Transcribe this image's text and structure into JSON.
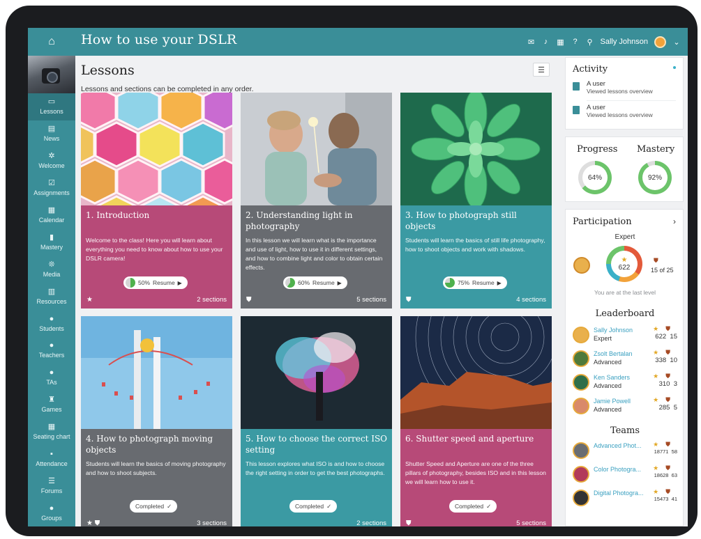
{
  "header": {
    "title": "How to use your DSLR",
    "user": "Sally Johnson"
  },
  "sidebar": {
    "items": [
      {
        "label": "Lessons",
        "icon": "lessons-icon",
        "glyph": "▭",
        "active": true
      },
      {
        "label": "News",
        "icon": "news-icon",
        "glyph": "▤"
      },
      {
        "label": "Welcome",
        "icon": "welcome-icon",
        "glyph": "✲"
      },
      {
        "label": "Assignments",
        "icon": "assignments-icon",
        "glyph": "☑"
      },
      {
        "label": "Calendar",
        "icon": "calendar-icon",
        "glyph": "▦"
      },
      {
        "label": "Mastery",
        "icon": "mastery-icon",
        "glyph": "▮"
      },
      {
        "label": "Media",
        "icon": "media-icon",
        "glyph": "❊"
      },
      {
        "label": "Resources",
        "icon": "resources-icon",
        "glyph": "▥"
      },
      {
        "label": "Students",
        "icon": "students-icon",
        "glyph": "●"
      },
      {
        "label": "Teachers",
        "icon": "teachers-icon",
        "glyph": "●"
      },
      {
        "label": "TAs",
        "icon": "tas-icon",
        "glyph": "●"
      },
      {
        "label": "Games",
        "icon": "games-icon",
        "glyph": "♜"
      },
      {
        "label": "Seating chart",
        "icon": "seating-chart-icon",
        "glyph": "▦"
      },
      {
        "label": "Attendance",
        "icon": "attendance-icon",
        "glyph": "▪"
      },
      {
        "label": "Forums",
        "icon": "forums-icon",
        "glyph": "☰"
      },
      {
        "label": "Groups",
        "icon": "groups-icon",
        "glyph": "●"
      }
    ]
  },
  "main": {
    "title": "Lessons",
    "subtitle": "Lessons and sections can be completed in any order.",
    "lessons": [
      {
        "title": "1. Introduction",
        "description": "Welcome to the class! Here you will learn about everything you need to know about how to use your DSLR camera!",
        "progress": 50,
        "action": "Resume",
        "sections": "2 sections",
        "color": "#b74a78",
        "image": "colorful-hexagons",
        "foot_icons": [
          "star"
        ]
      },
      {
        "title": "2. Understanding light in photography",
        "description": "In this lesson we will learn what is the importance and use of light, how to use it in different settings, and how to combine light and color to obtain certain effects.",
        "progress": 60,
        "action": "Resume",
        "sections": "5 sections",
        "color": "#686b70",
        "image": "father-and-child-sparkler",
        "foot_icons": [
          "shield"
        ]
      },
      {
        "title": "3. How to photograph still objects",
        "description": "Students will learn the basics of still life photography, how to shoot objects and work with shadows.",
        "progress": 75,
        "action": "Resume",
        "sections": "4 sections",
        "color": "#3b9aa3",
        "image": "succulent-plant",
        "foot_icons": [
          "shield"
        ]
      },
      {
        "title": "4. How to photograph moving objects",
        "description": "Students will learn the basics of moving photography and how to shoot subjects.",
        "status": "Completed",
        "sections": "3 sections",
        "color": "#686b70",
        "image": "swing-ride",
        "foot_icons": [
          "star",
          "shield"
        ]
      },
      {
        "title": "5. How to choose the correct ISO setting",
        "description": "This lesson explores what ISO is and how to choose the right setting in order to get the best photographs.",
        "status": "Completed",
        "sections": "2 sections",
        "color": "#3b9aa3",
        "image": "color-powder-burst",
        "foot_icons": []
      },
      {
        "title": "6. Shutter speed and aperture",
        "description": "Shutter Speed and Aperture are one of the three pillars of photography, besides ISO and in this lesson we will learn how to use it.",
        "status": "Completed",
        "sections": "5 sections",
        "color": "#b74a78",
        "image": "star-trails-canyon",
        "foot_icons": [
          "shield"
        ]
      }
    ]
  },
  "activity": {
    "title": "Activity",
    "items": [
      {
        "user": "A user",
        "action": "Viewed lessons overview"
      },
      {
        "user": "A user",
        "action": "Viewed lessons overview"
      }
    ]
  },
  "progress": {
    "label": "Progress",
    "value": 64,
    "display": "64%",
    "color": "#6cc46a"
  },
  "mastery": {
    "label": "Mastery",
    "value": 92,
    "display": "92%",
    "color": "#6cc46a"
  },
  "participation": {
    "title": "Participation",
    "level": "Expert",
    "points": "622",
    "badges": "15 of 25",
    "note": "You are at the last level"
  },
  "leaderboard": {
    "title": "Leaderboard",
    "rows": [
      {
        "name": "Sally Johnson",
        "level": "Expert",
        "points": "622",
        "badges": "15",
        "avatar": "#e9b04c"
      },
      {
        "name": "Zsolt Bertalan",
        "level": "Advanced",
        "points": "338",
        "badges": "10",
        "avatar": "#4f7a3a"
      },
      {
        "name": "Ken Sanders",
        "level": "Advanced",
        "points": "310",
        "badges": "3",
        "avatar": "#2f6f4a"
      },
      {
        "name": "Jamie Powell",
        "level": "Advanced",
        "points": "285",
        "badges": "5",
        "avatar": "#d98a6a"
      }
    ]
  },
  "teams": {
    "title": "Teams",
    "rows": [
      {
        "name": "Advanced Phot...",
        "points": "18771",
        "badges": "58",
        "avatar": "#6a6d72"
      },
      {
        "name": "Color Photogra...",
        "points": "18628",
        "badges": "63",
        "avatar": "#b23a5a"
      },
      {
        "name": "Digital Photogra...",
        "points": "15473",
        "badges": "41",
        "avatar": "#333"
      }
    ]
  }
}
